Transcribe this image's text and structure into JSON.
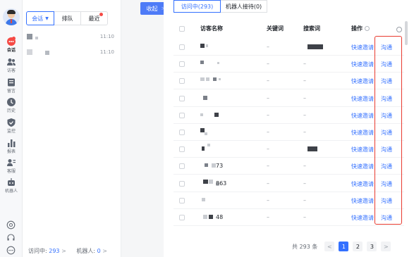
{
  "rail": {
    "items": [
      {
        "icon": "chat-icon",
        "label": "会话"
      },
      {
        "icon": "visitor-icon",
        "label": "访客"
      },
      {
        "icon": "ticket-icon",
        "label": "留言"
      },
      {
        "icon": "history-icon",
        "label": "历史"
      },
      {
        "icon": "monitor-icon",
        "label": "监控"
      },
      {
        "icon": "report-icon",
        "label": "报表"
      },
      {
        "icon": "service-icon",
        "label": "客服"
      },
      {
        "icon": "robot-icon",
        "label": "机器人"
      }
    ]
  },
  "sessions": {
    "tabs": {
      "t1": "会话",
      "t2": "排队",
      "t3": "最近"
    },
    "rows": [
      {
        "time": "11:10"
      },
      {
        "time": "11:10"
      }
    ],
    "footer": {
      "visiting_label": "访问中:",
      "visiting_count": "293",
      "robot_label": "机器人:",
      "robot_count": "0",
      "arrow": ">"
    }
  },
  "collapse": {
    "label": "收起",
    "chevron": ">"
  },
  "main": {
    "tabs": {
      "active": "访问中(293)",
      "other": "机器人接待(0)"
    },
    "headers": {
      "name": "访客名称",
      "keyword": "关键词",
      "search": "搜索词",
      "action": "操作"
    },
    "rows": [
      {
        "name_suffix": "",
        "keyword": "–",
        "search": "",
        "invite": "快速邀请",
        "chat": "沟通"
      },
      {
        "name_suffix": "",
        "keyword": "–",
        "search": "–",
        "invite": "快速邀请",
        "chat": "沟通"
      },
      {
        "name_suffix": "",
        "keyword": "–",
        "search": "–",
        "invite": "快速邀请",
        "chat": "沟通"
      },
      {
        "name_suffix": "",
        "keyword": "–",
        "search": "–",
        "invite": "快速邀请",
        "chat": "沟通"
      },
      {
        "name_suffix": "",
        "keyword": "–",
        "search": "–",
        "invite": "快速邀请",
        "chat": "沟通"
      },
      {
        "name_suffix": "",
        "keyword": "–",
        "search": "–",
        "invite": "快速邀请",
        "chat": "沟通"
      },
      {
        "name_suffix": "",
        "keyword": "–",
        "search": "",
        "invite": "快速邀请",
        "chat": "沟通"
      },
      {
        "name_suffix": "73",
        "keyword": "–",
        "search": "–",
        "invite": "快速邀请",
        "chat": "沟通"
      },
      {
        "name_suffix": "863",
        "keyword": "–",
        "search": "–",
        "invite": "快速邀请",
        "chat": "沟通"
      },
      {
        "name_suffix": "",
        "keyword": "–",
        "search": "–",
        "invite": "快速邀请",
        "chat": "沟通"
      },
      {
        "name_suffix": "48",
        "keyword": "–",
        "search": "–",
        "invite": "快速邀请",
        "chat": "沟通"
      }
    ],
    "pagination": {
      "total": "共 293 条",
      "prev": "<",
      "pages": [
        "1",
        "2",
        "3"
      ],
      "next": ">"
    }
  },
  "colors": {
    "accent": "#3370ff",
    "collapse_button": "#4e7bf7",
    "highlight_box": "#e83a2f",
    "badge": "#f54a45"
  }
}
